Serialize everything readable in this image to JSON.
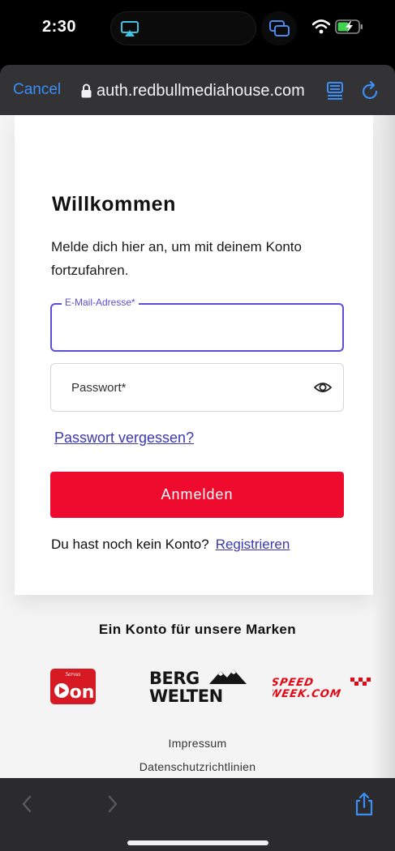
{
  "status_bar": {
    "time": "2:30"
  },
  "browser": {
    "cancel_label": "Cancel",
    "url": "auth.redbullmediahouse.com"
  },
  "login": {
    "title": "Willkommen",
    "subtitle": "Melde dich hier an, um mit deinem Konto fortzufahren.",
    "email_label": "E-Mail-Adresse*",
    "email_value": "",
    "password_placeholder": "Passwort*",
    "forgot_link": "Passwort vergessen?",
    "submit_label": "Anmelden",
    "no_account_text": "Du hast noch kein Konto?",
    "register_link": "Registrieren"
  },
  "brands": {
    "title": "Ein Konto für unsere Marken",
    "on_label": "on",
    "bergwelten_line1": "BERG",
    "bergwelten_line2": "WELTEN",
    "speedweek": "SPEEDWEEK.COM"
  },
  "footer": {
    "impressum": "Impressum",
    "privacy": "Datenschutzrichtlinien"
  },
  "colors": {
    "accent_blue": "#3a8ef7",
    "primary_red": "#ee0b2d",
    "focus_purple": "#5a4fd6",
    "link_color": "#3b38b0"
  },
  "icons": [
    "airplay-icon",
    "screen-mirror-icon",
    "wifi-icon",
    "battery-icon",
    "lock-icon",
    "reader-icon",
    "reload-icon",
    "eye-icon",
    "back-icon",
    "forward-icon",
    "share-icon"
  ]
}
